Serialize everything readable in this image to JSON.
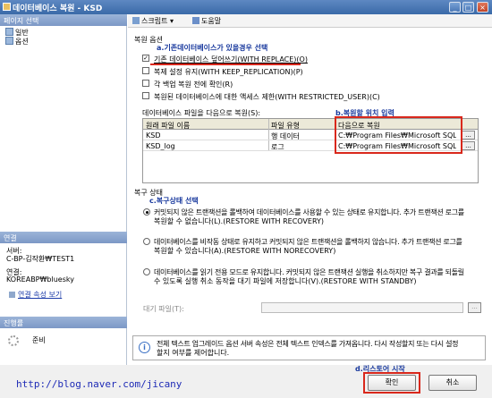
{
  "window": {
    "title": "데이터베이스 복원 - KSD",
    "min": "_",
    "max": "□",
    "close": "×"
  },
  "sidebar": {
    "pages_header": "페이지 선택",
    "items": [
      {
        "label": "일반"
      },
      {
        "label": "옵션"
      }
    ],
    "connection_header": "연결",
    "server_label": "서버:",
    "server_value": "C-BP-김작환₩TEST1",
    "conn_label": "연결:",
    "conn_value": "KOREABP₩bluesky",
    "conn_props_link": "연결 속성 보기",
    "progress_header": "진행률",
    "progress_status": "준비"
  },
  "toolbar": {
    "script": "스크립트",
    "script_arrow": "▾",
    "help": "도움말"
  },
  "restore_options": {
    "section": "복원 옵션",
    "annotation_a": "a.기존데이터베이스가 있을경우 선택",
    "overwrite": "기존 데이터베이스 덮어쓰기(WITH REPLACE)(O)",
    "overwrite_checked": true,
    "keep_replication": "복제 설정 유지(WITH KEEP_REPLICATION)(P)",
    "prompt_each": "각 백업 복원 전에 확인(R)",
    "restricted": "복원된 데이터베이스에 대한 액세스 제한(WITH RESTRICTED_USER)(C)"
  },
  "files": {
    "label": "데이터베이스 파일을 다음으로 복원(S):",
    "annotation_b": "b.복원할 위치 입력",
    "headers": [
      "원래 파일 이름",
      "파일 유형",
      "다음으로 복원"
    ],
    "rows": [
      {
        "name": "KSD",
        "type": "행 데이터",
        "path": "C:₩Program Files₩Microsoft SQL ...",
        "btn": "..."
      },
      {
        "name": "KSD_log",
        "type": "로그",
        "path": "C:₩Program Files₩Microsoft SQL ...",
        "btn": "..."
      }
    ]
  },
  "recovery": {
    "section": "복구 상태",
    "annotation_c": "c.복구상태 선택",
    "opt1_l1": "커밋되지 않은 트랜잭션을 롤백하여 데이터베이스를 사용할 수 있는 상태로 유지합니다. 추가 트랜잭션 로그를",
    "opt1_l2": "복원할 수 없습니다(L).(RESTORE WITH RECOVERY)",
    "opt2_l1": "데이터베이스를 비작동 상태로 유지하고 커밋되지 않은 트랜잭션을 롤백하지 않습니다. 추가 트랜잭션 로그를",
    "opt2_l2": "복원할 수 있습니다(A).(RESTORE WITH NORECOVERY)",
    "opt3_l1": "데이터베이스를 읽기 전용 모드로 유지합니다. 커밋되지 않은 트랜잭션 실행을 취소하지만 복구 결과를 되돌릴",
    "opt3_l2": "수 있도록 실행 취소 동작을 대기 파일에 저장합니다(V).(RESTORE WITH STANDBY)",
    "standby_label": "대기 파일(T):",
    "standby_value": "",
    "standby_btn": "..."
  },
  "info": {
    "l1": "전체 텍스트 업그레이드 옵션 서버 속성은 전체 텍스트 인덱스를 가져옵니다. 다시 작성할지 또는 다시 설정",
    "l2": "할지 여부를 제어합니다.",
    "icon": "i"
  },
  "buttons": {
    "ok": "확인",
    "cancel": "취소",
    "annotation_d": "d.리스토어 시작"
  },
  "watermark": "http://blog.naver.com/jicany",
  "colors": {
    "annotation": "#1a3a9e",
    "highlight": "#d9281c",
    "title": "#3a6aa8"
  }
}
